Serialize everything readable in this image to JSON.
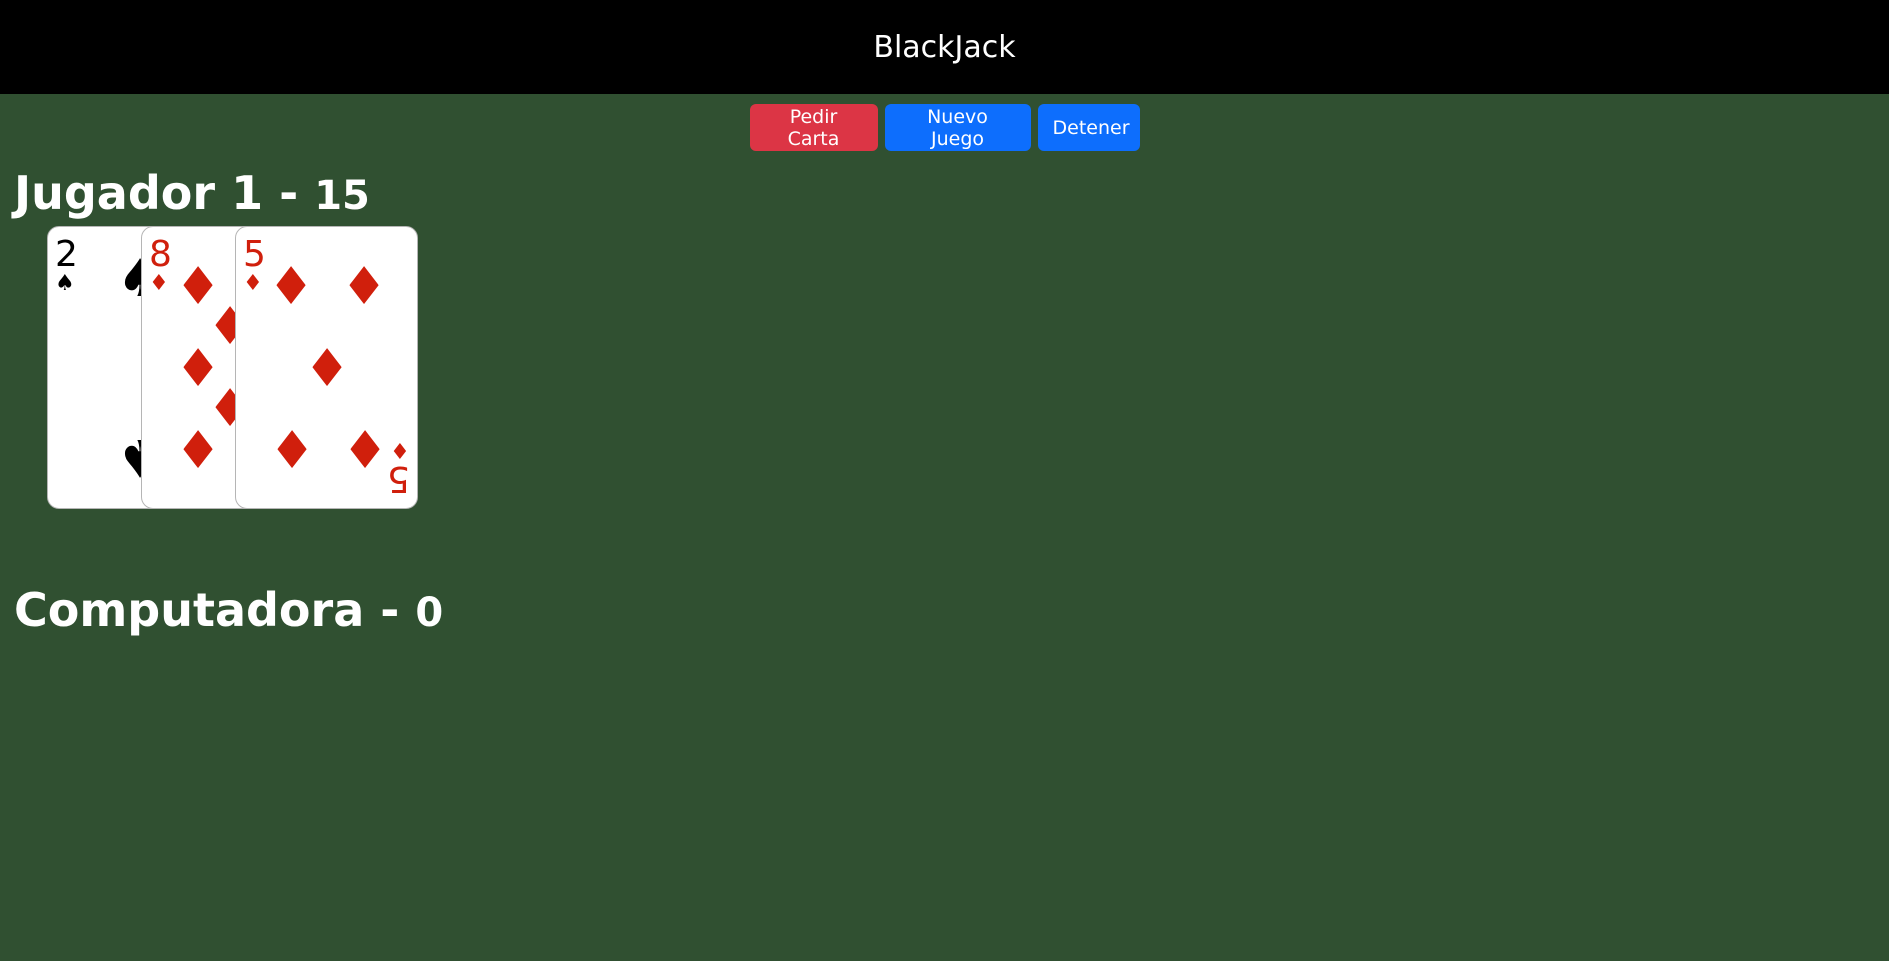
{
  "header": {
    "title": "BlackJack"
  },
  "toolbar": {
    "pedir_label": "Pedir Carta",
    "nuevo_label": "Nuevo Juego",
    "detener_label": "Detener"
  },
  "colors": {
    "table": "#305031",
    "header": "#000000",
    "danger": "#dc3545",
    "primary": "#0d6efd",
    "red_suit": "#d01f0c"
  },
  "players": [
    {
      "name": "Jugador 1",
      "separator": "-",
      "score": "15",
      "cards": [
        {
          "rank": "2",
          "suit": "♠"
        },
        {
          "rank": "8",
          "suit": "♦"
        },
        {
          "rank": "5",
          "suit": "♦"
        }
      ]
    },
    {
      "name": "Computadora",
      "separator": "-",
      "score": "0",
      "cards": []
    }
  ]
}
